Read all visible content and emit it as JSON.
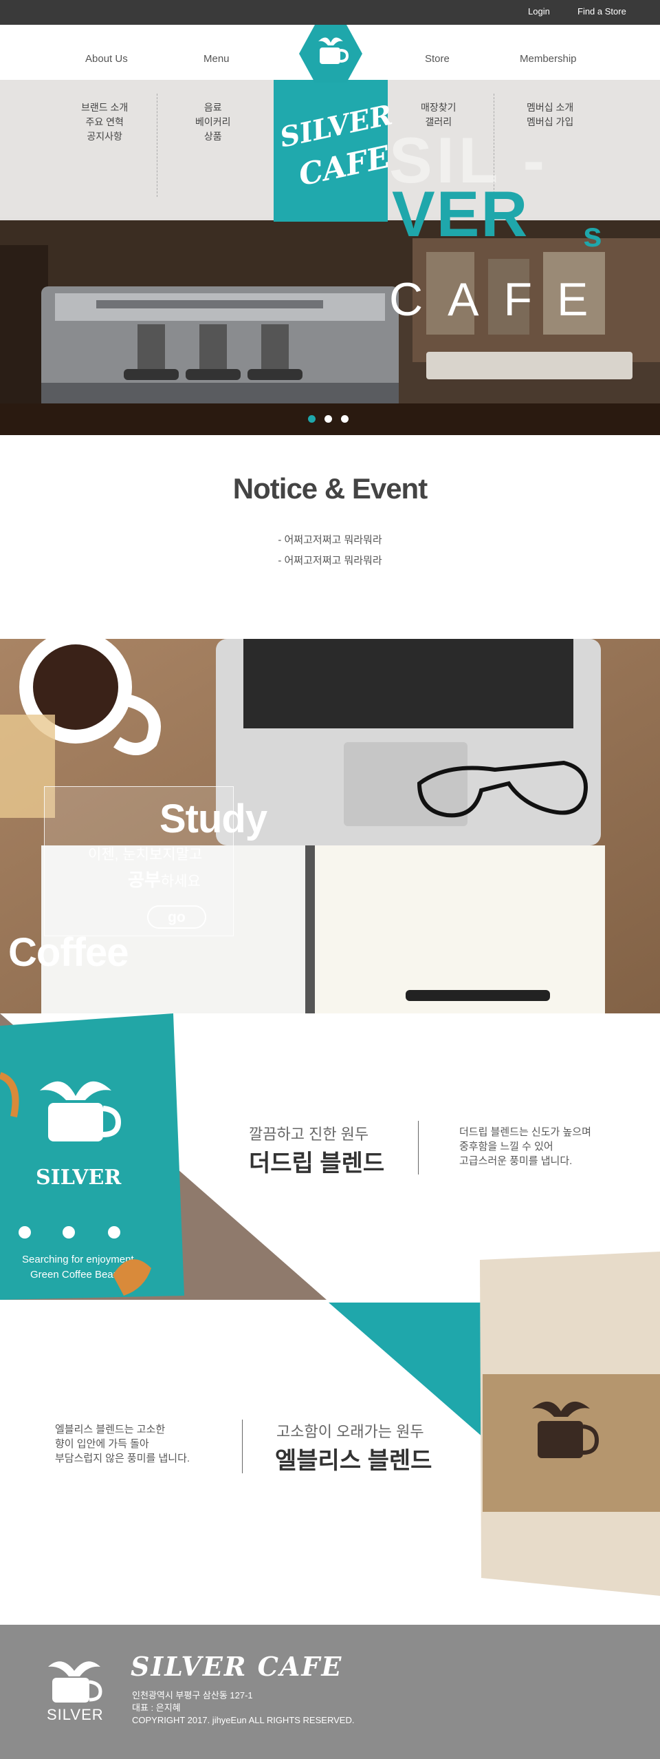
{
  "topbar": {
    "login": "Login",
    "find_store": "Find a Store"
  },
  "nav": {
    "items": [
      "About Us",
      "Menu",
      "Store",
      "Membership"
    ]
  },
  "submenu": {
    "col1": [
      "브랜드 소개",
      "주요 연혁",
      "공지사항"
    ],
    "col2": [
      "음료",
      "베이커리",
      "상품"
    ],
    "col3": [
      "매장찾기",
      "갤러리"
    ],
    "col4": [
      "멤버십 소개",
      "멤버십 가입"
    ]
  },
  "hero": {
    "brand_line1": "SILVER",
    "brand_line2": "CAFE",
    "big_sil": "SIL -",
    "big_ver": "VER",
    "big_s": "s",
    "big_cafe": "CAFE",
    "slides": 3,
    "active_slide": 1
  },
  "notice": {
    "title": "Notice & Event",
    "items": [
      "- 어쩌고저쩌고 뭐라뭐라",
      "- 어쩌고저쩌고 뭐라뭐라"
    ]
  },
  "study": {
    "word": "Study",
    "line1": "이젠, 눈치보지말고",
    "line2_bold": "공부",
    "line2_rest": "하세요",
    "go": "go",
    "coffee": "Coffee"
  },
  "product1": {
    "sub": "깔끔하고 진한 원두",
    "name": "더드립 블렌드",
    "desc": [
      "더드립 블렌드는 신도가 높으며",
      "중후함을 느낄 수 있어",
      "고급스러운 풍미를 냅니다."
    ],
    "bag_brand": "SILVER",
    "bag_tag1": "Searching for enjoyment",
    "bag_tag2": "Green Coffee Bean"
  },
  "product2": {
    "sub": "고소함이 오래가는 원두",
    "name": "엘블리스 블렌드",
    "desc": [
      "엘블리스 블렌드는 고소한",
      "향이 입안에 가득 돌아",
      "부담스럽지 않은 풍미를 냅니다."
    ]
  },
  "footer": {
    "title": "SILVER CAFE",
    "logo_text": "SILVER",
    "address": "인천광역시 부평구 삼산동 127-1",
    "ceo": "대표 : 은지혜",
    "copyright": "COPYRIGHT 2017. jihyeEun ALL RIGHTS RESERVED."
  },
  "colors": {
    "accent": "#1fa7ab",
    "topbar": "#3a3a3a",
    "footer": "#8c8c8c"
  }
}
